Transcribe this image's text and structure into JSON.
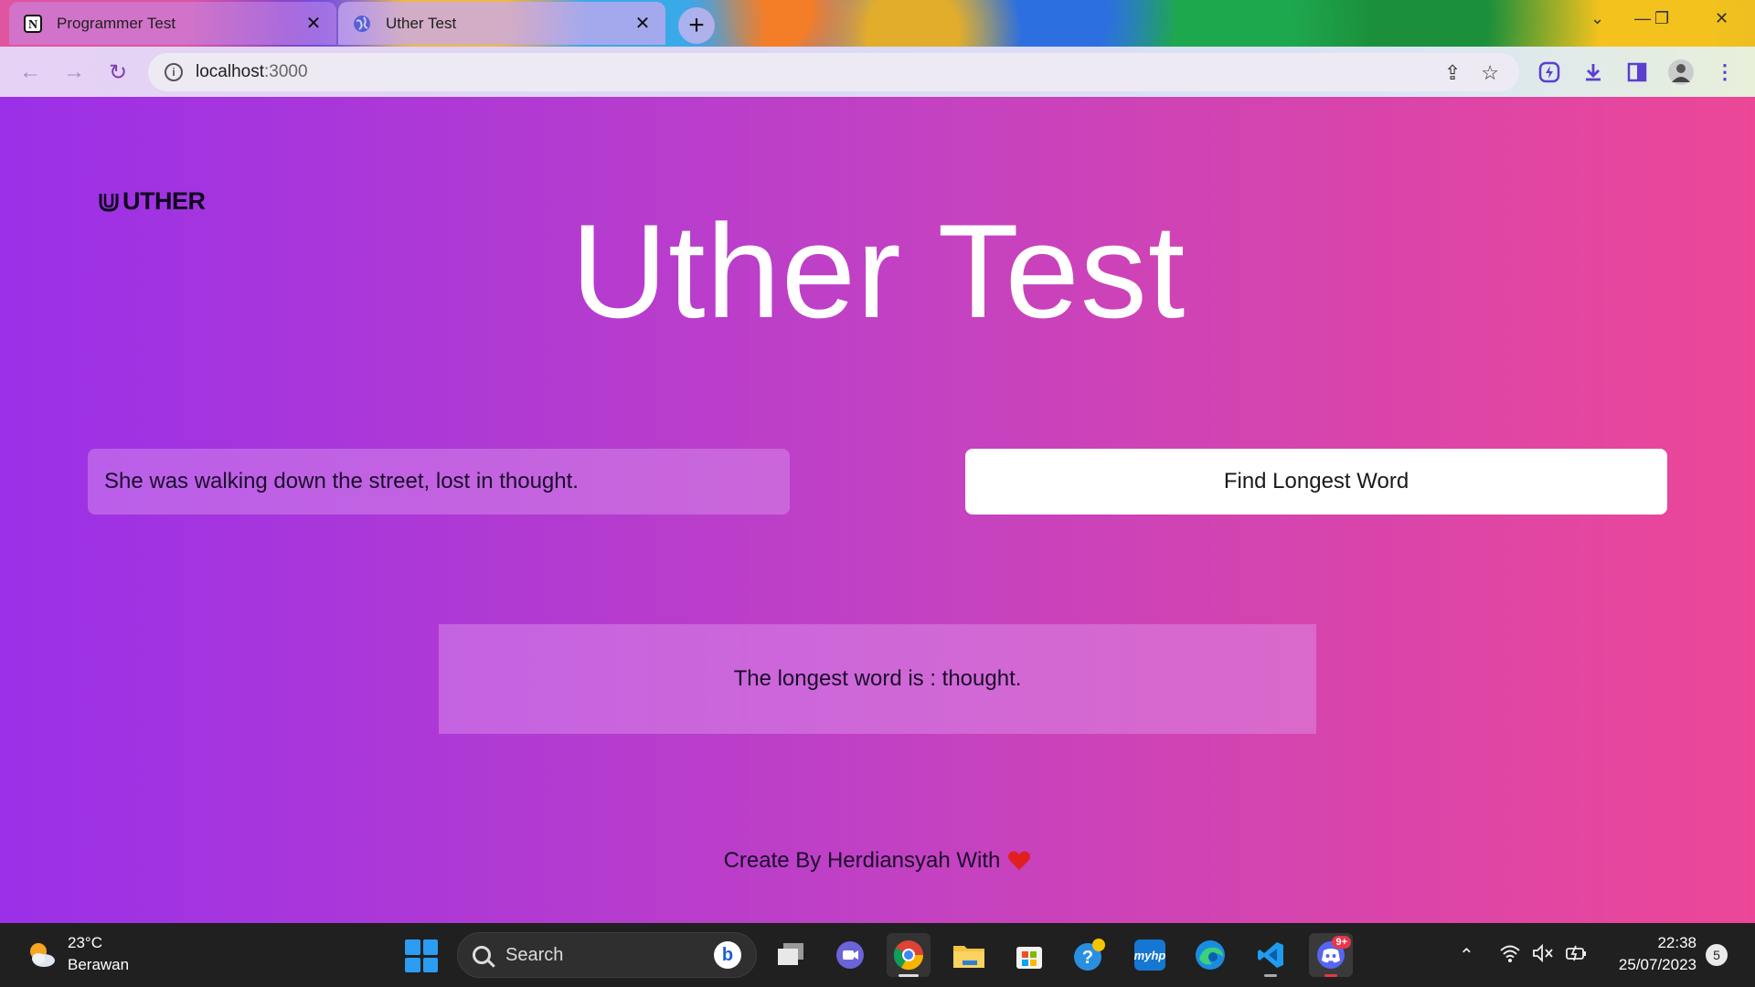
{
  "browser": {
    "tabs": [
      {
        "title": "Programmer Test",
        "favicon": "notion-icon",
        "active": false
      },
      {
        "title": "Uther Test",
        "favicon": "globe-icon",
        "active": true
      }
    ],
    "url_host": "localhost",
    "url_port": ":3000"
  },
  "page": {
    "logo_text": "UTHER",
    "title": "Uther Test",
    "input": {
      "value": "She was walking down the street, lost in thought.",
      "placeholder": ""
    },
    "button_label": "Find Longest Word",
    "result_text": "The longest word is : thought.",
    "footer_text": "Create By Herdiansyah With",
    "heart_color": "#e02020",
    "colors": {
      "gradient_start": "#9b30e8",
      "gradient_end": "#ec4797"
    }
  },
  "taskbar": {
    "weather_temp": "23°C",
    "weather_desc": "Berawan",
    "search_label": "Search",
    "discord_badge": "9+",
    "clock_time": "22:38",
    "clock_date": "25/07/2023",
    "notification_count": "5"
  }
}
